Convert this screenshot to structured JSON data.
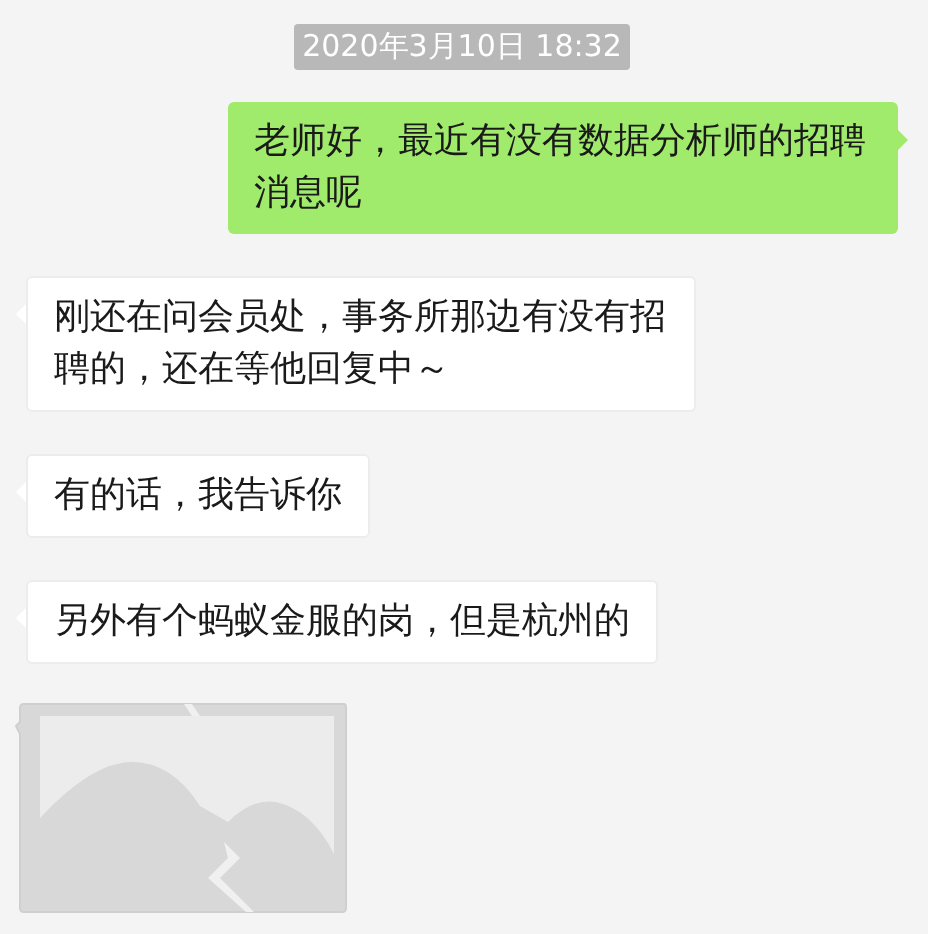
{
  "timestamp": "2020年3月10日 18:32",
  "messages": [
    {
      "outgoing": true,
      "kind": "text",
      "text": "老师好，最近有没有数据分析师的招聘消息呢"
    },
    {
      "outgoing": false,
      "kind": "text",
      "text": "刚还在问会员处，事务所那边有没有招聘的，还在等他回复中～"
    },
    {
      "outgoing": false,
      "kind": "text",
      "text": "有的话，我告诉你"
    },
    {
      "outgoing": false,
      "kind": "text",
      "text": "另外有个蚂蚁金服的岗，但是杭州的"
    },
    {
      "outgoing": false,
      "kind": "image"
    }
  ]
}
